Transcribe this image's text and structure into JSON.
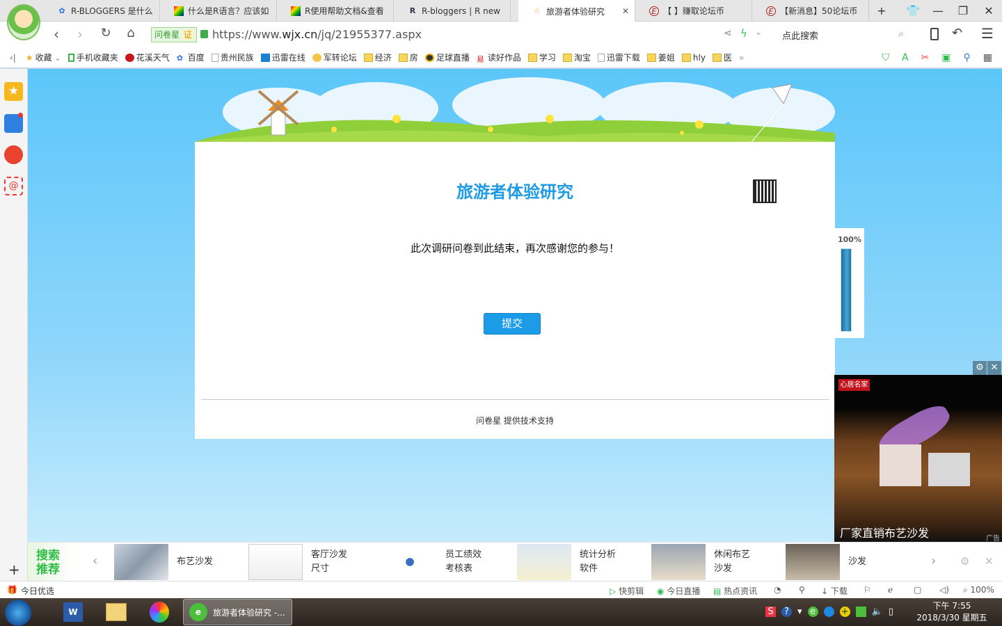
{
  "browser": {
    "tabs": [
      {
        "label": "R-BLOGGERS 是什么",
        "icon": "baidu-paw-icon"
      },
      {
        "label": "什么是R语言？应该如",
        "icon": "colorful-site-icon"
      },
      {
        "label": "R使用帮助文档&查看",
        "icon": "colorful-site-icon"
      },
      {
        "label": "R-bloggers | R new",
        "icon": "r-logo-icon"
      },
      {
        "label": "旅游者体验研究",
        "icon": "star-icon",
        "active": true
      },
      {
        "label": "【        】赚取论坛币",
        "icon": "e-forum-icon"
      },
      {
        "label": "【新消息】50论坛币",
        "icon": "e-forum-icon"
      }
    ],
    "site_badge": "问卷星",
    "site_badge_cert": "证",
    "url_prefix": "https://www.",
    "url_domain": "wjx.cn",
    "url_path": "/jq/21955377.aspx",
    "search_placeholder": "点此搜索",
    "bookmarks": [
      "收藏",
      "手机收藏夹",
      "花溪天气",
      "百度",
      "贵州民族",
      "迅雷在线",
      "军转论坛",
      "经济",
      "房",
      "足球直播",
      "读好作品",
      "学习",
      "淘宝",
      "迅雷下载",
      "姜姐",
      "hly",
      "医"
    ],
    "more": "»"
  },
  "page": {
    "title": "旅游者体验研究",
    "message": "此次调研问卷到此结束，再次感谢您的参与！",
    "submit_label": "提交",
    "footer": "问卷星 提供技术支持",
    "progress_label": "100%",
    "progress_value": 100
  },
  "ad": {
    "logo": "心居名家",
    "caption": "厂家直销布艺沙发",
    "tag": "广告"
  },
  "recommend": {
    "label_line1": "搜索",
    "label_line2": "推荐",
    "items": [
      {
        "l1": "布艺沙发",
        "l2": ""
      },
      {
        "l1": "客厅沙发",
        "l2": "尺寸"
      },
      {
        "l1": "员工绩效",
        "l2": "考核表"
      },
      {
        "l1": "统计分析",
        "l2": "软件"
      },
      {
        "l1": "休闲布艺",
        "l2": "沙发"
      },
      {
        "l1": "沙发",
        "l2": ""
      }
    ]
  },
  "statusbar": {
    "left": "今日优选",
    "items": [
      "快剪辑",
      "今日直播",
      "热点资讯",
      "下载"
    ],
    "zoom": "100%"
  },
  "taskbar": {
    "active_window": "旅游者体验研究 -...",
    "time": "下午 7:55",
    "date": "2018/3/30 星期五"
  }
}
